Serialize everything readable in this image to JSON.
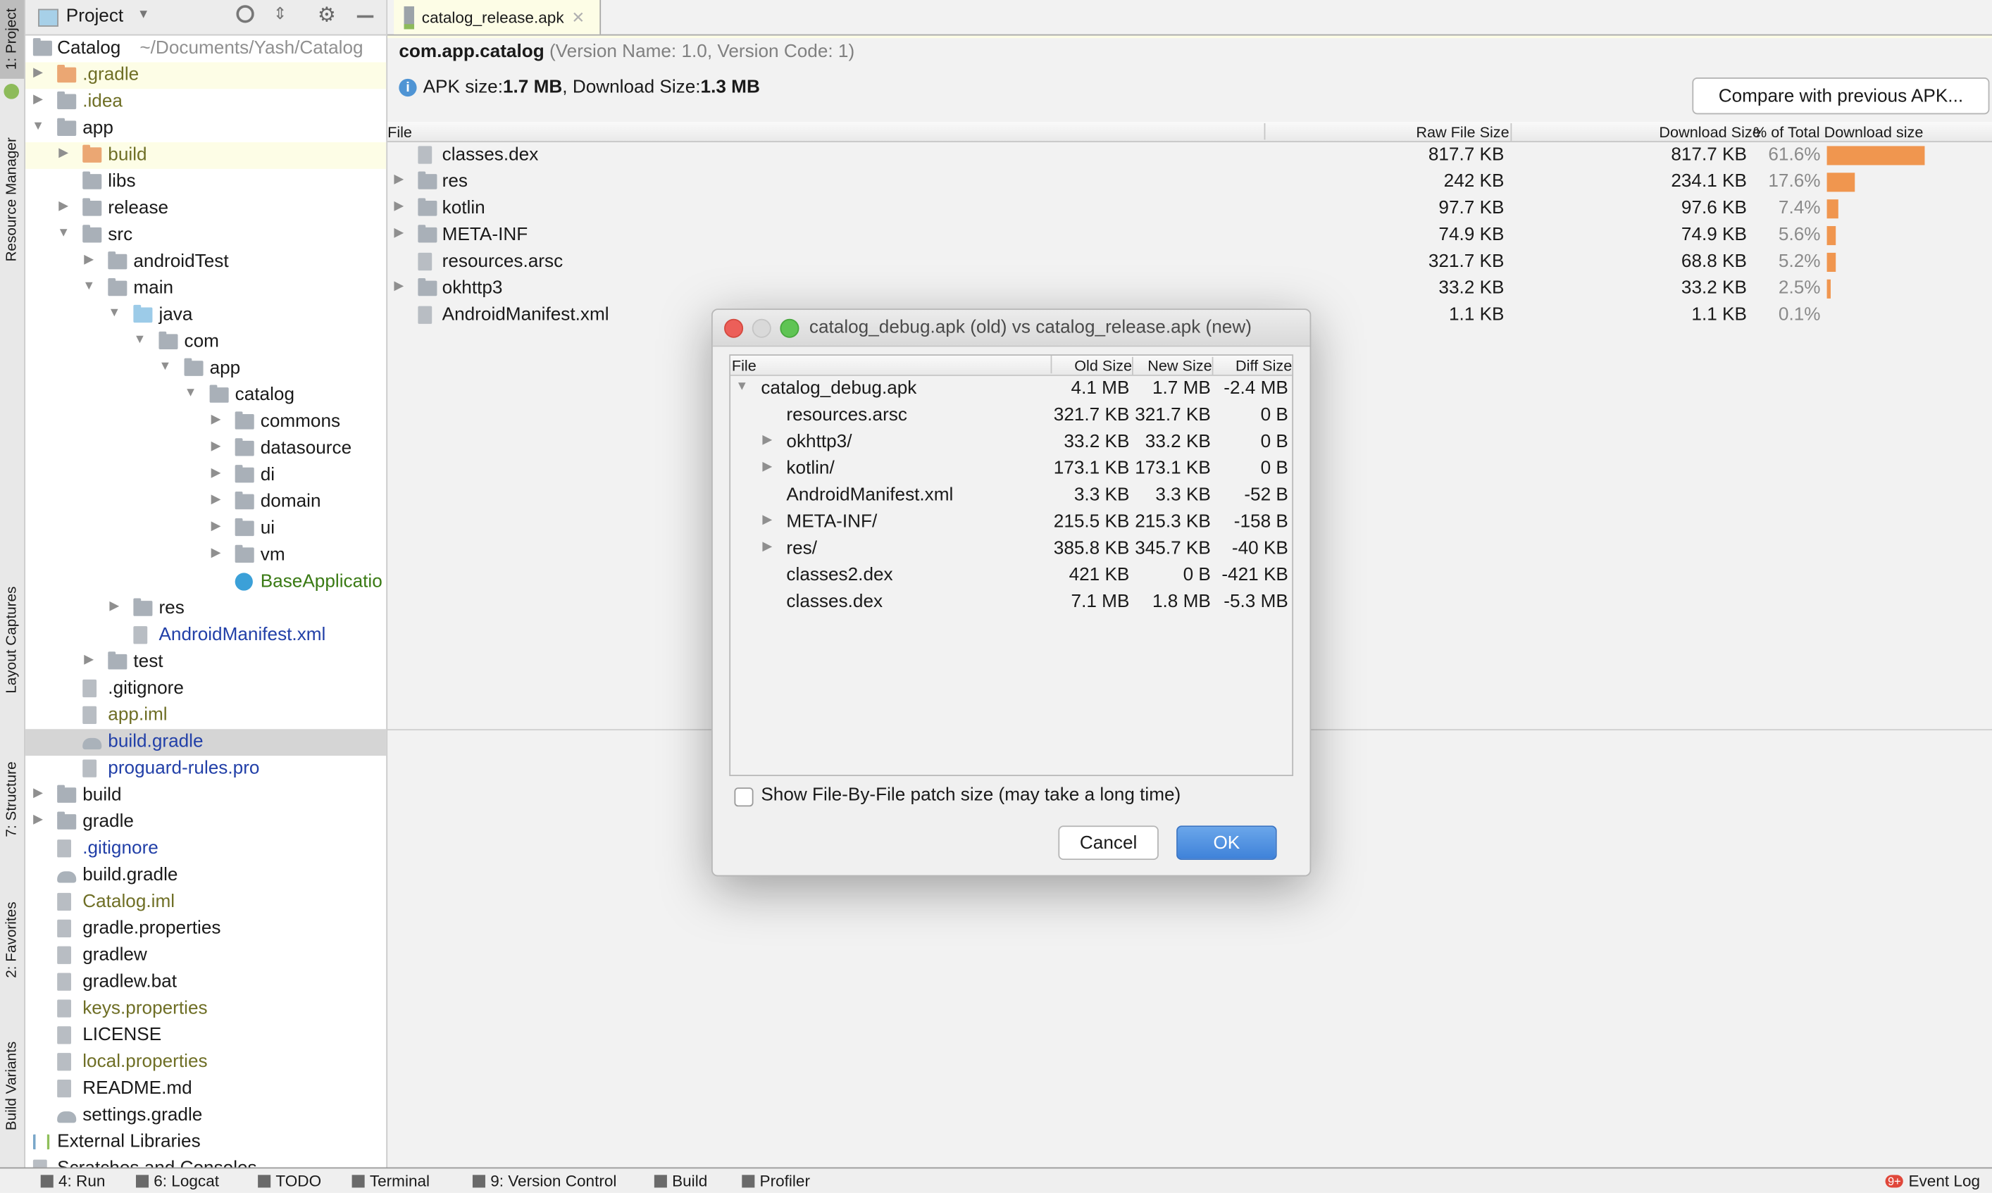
{
  "sidebar_strip": {
    "tabs": [
      "1: Project",
      "Resource Manager",
      "Layout Captures",
      "7: Structure",
      "2: Favorites",
      "Build Variants"
    ]
  },
  "project_panel": {
    "title": "Project",
    "tree": [
      {
        "label": "Catalog",
        "hint": "~/Documents/Yash/Catalog",
        "level": -1,
        "arrow": "none",
        "icon": "folder-project",
        "style": ""
      },
      {
        "label": ".gradle",
        "level": 0,
        "arrow": "right",
        "icon": "folder-excluded",
        "style": "olive",
        "row": "hl"
      },
      {
        "label": ".idea",
        "level": 0,
        "arrow": "right",
        "icon": "folder-idea",
        "style": "olive"
      },
      {
        "label": "app",
        "level": 0,
        "arrow": "down",
        "icon": "folder-module",
        "style": ""
      },
      {
        "label": "build",
        "level": 1,
        "arrow": "right",
        "icon": "folder-excluded",
        "style": "olive",
        "row": "hl"
      },
      {
        "label": "libs",
        "level": 1,
        "arrow": "none",
        "icon": "folder",
        "style": ""
      },
      {
        "label": "release",
        "level": 1,
        "arrow": "right",
        "icon": "folder",
        "style": ""
      },
      {
        "label": "src",
        "level": 1,
        "arrow": "down",
        "icon": "folder",
        "style": ""
      },
      {
        "label": "androidTest",
        "level": 2,
        "arrow": "right",
        "icon": "folder",
        "style": ""
      },
      {
        "label": "main",
        "level": 2,
        "arrow": "down",
        "icon": "folder",
        "style": ""
      },
      {
        "label": "java",
        "level": 3,
        "arrow": "down",
        "icon": "folder-source",
        "style": ""
      },
      {
        "label": "com",
        "level": 4,
        "arrow": "down",
        "icon": "package",
        "style": ""
      },
      {
        "label": "app",
        "level": 5,
        "arrow": "down",
        "icon": "package",
        "style": ""
      },
      {
        "label": "catalog",
        "level": 6,
        "arrow": "down",
        "icon": "package",
        "style": ""
      },
      {
        "label": "commons",
        "level": 7,
        "arrow": "right",
        "icon": "package",
        "style": ""
      },
      {
        "label": "datasource",
        "level": 7,
        "arrow": "right",
        "icon": "package",
        "style": ""
      },
      {
        "label": "di",
        "level": 7,
        "arrow": "right",
        "icon": "package",
        "style": ""
      },
      {
        "label": "domain",
        "level": 7,
        "arrow": "right",
        "icon": "package",
        "style": ""
      },
      {
        "label": "ui",
        "level": 7,
        "arrow": "right",
        "icon": "package",
        "style": ""
      },
      {
        "label": "vm",
        "level": 7,
        "arrow": "right",
        "icon": "package",
        "style": ""
      },
      {
        "label": "BaseApplicatio",
        "level": 7,
        "arrow": "none",
        "icon": "kotlin-class",
        "style": "green"
      },
      {
        "label": "res",
        "level": 3,
        "arrow": "right",
        "icon": "folder-res",
        "style": ""
      },
      {
        "label": "AndroidManifest.xml",
        "level": 3,
        "arrow": "none",
        "icon": "manifest-file",
        "style": "blue"
      },
      {
        "label": "test",
        "level": 2,
        "arrow": "right",
        "icon": "folder",
        "style": ""
      },
      {
        "label": ".gitignore",
        "level": 1,
        "arrow": "none",
        "icon": "file",
        "style": ""
      },
      {
        "label": "app.iml",
        "level": 1,
        "arrow": "none",
        "icon": "file",
        "style": "olive"
      },
      {
        "label": "build.gradle",
        "level": 1,
        "arrow": "none",
        "icon": "gradle-file",
        "style": "blue",
        "row": "sel"
      },
      {
        "label": "proguard-rules.pro",
        "level": 1,
        "arrow": "none",
        "icon": "file",
        "style": "blue"
      },
      {
        "label": "build",
        "level": 0,
        "arrow": "right",
        "icon": "folder",
        "style": ""
      },
      {
        "label": "gradle",
        "level": 0,
        "arrow": "right",
        "icon": "folder",
        "style": ""
      },
      {
        "label": ".gitignore",
        "level": 0,
        "arrow": "none",
        "icon": "file",
        "style": "blue"
      },
      {
        "label": "build.gradle",
        "level": 0,
        "arrow": "none",
        "icon": "gradle-file",
        "style": ""
      },
      {
        "label": "Catalog.iml",
        "level": 0,
        "arrow": "none",
        "icon": "file",
        "style": "olive"
      },
      {
        "label": "gradle.properties",
        "level": 0,
        "arrow": "none",
        "icon": "properties-file",
        "style": ""
      },
      {
        "label": "gradlew",
        "level": 0,
        "arrow": "none",
        "icon": "file",
        "style": ""
      },
      {
        "label": "gradlew.bat",
        "level": 0,
        "arrow": "none",
        "icon": "file",
        "style": ""
      },
      {
        "label": "keys.properties",
        "level": 0,
        "arrow": "none",
        "icon": "properties-file",
        "style": "olive"
      },
      {
        "label": "LICENSE",
        "level": 0,
        "arrow": "none",
        "icon": "file",
        "style": ""
      },
      {
        "label": "local.properties",
        "level": 0,
        "arrow": "none",
        "icon": "properties-file",
        "style": "olive"
      },
      {
        "label": "README.md",
        "level": 0,
        "arrow": "none",
        "icon": "file",
        "style": ""
      },
      {
        "label": "settings.gradle",
        "level": 0,
        "arrow": "none",
        "icon": "gradle-file",
        "style": ""
      },
      {
        "label": "External Libraries",
        "level": -1,
        "arrow": "none",
        "icon": "libraries",
        "style": ""
      },
      {
        "label": "Scratches and Consoles",
        "level": -1,
        "arrow": "none",
        "icon": "scratches",
        "style": ""
      }
    ]
  },
  "editor": {
    "tab_label": "catalog_release.apk",
    "package": "com.app.catalog",
    "version_info": "(Version Name: 1.0, Version Code: 1)",
    "size_prefix_apk": "APK size: ",
    "apk_size": "1.7 MB",
    "size_prefix_download": ", Download Size: ",
    "download_size": "1.3 MB",
    "compare_button": "Compare with previous APK...",
    "columns": [
      "File",
      "Raw File Size",
      "Download Size",
      "% of Total Download size"
    ],
    "accent_color": "#f0964f",
    "rows": [
      {
        "name": "classes.dex",
        "arrow": "none",
        "icon": "dex-file",
        "raw": "817.7 KB",
        "download": "817.7 KB",
        "percent_label": "61.6%",
        "percent": 61.6
      },
      {
        "name": "res",
        "arrow": "right",
        "icon": "folder-res",
        "raw": "242 KB",
        "download": "234.1 KB",
        "percent_label": "17.6%",
        "percent": 17.6
      },
      {
        "name": "kotlin",
        "arrow": "right",
        "icon": "folder",
        "raw": "97.7 KB",
        "download": "97.6 KB",
        "percent_label": "7.4%",
        "percent": 7.4
      },
      {
        "name": "META-INF",
        "arrow": "right",
        "icon": "folder",
        "raw": "74.9 KB",
        "download": "74.9 KB",
        "percent_label": "5.6%",
        "percent": 5.6
      },
      {
        "name": "resources.arsc",
        "arrow": "none",
        "icon": "arsc-file",
        "raw": "321.7 KB",
        "download": "68.8 KB",
        "percent_label": "5.2%",
        "percent": 5.2
      },
      {
        "name": "okhttp3",
        "arrow": "right",
        "icon": "folder",
        "raw": "33.2 KB",
        "download": "33.2 KB",
        "percent_label": "2.5%",
        "percent": 2.5
      },
      {
        "name": "AndroidManifest.xml",
        "arrow": "none",
        "icon": "xml-file",
        "raw": "1.1 KB",
        "download": "1.1 KB",
        "percent_label": "0.1%",
        "percent": 0.1
      }
    ]
  },
  "dialog": {
    "title": "catalog_debug.apk (old) vs catalog_release.apk (new)",
    "columns": [
      "File",
      "Old Size",
      "New Size",
      "Diff Size"
    ],
    "rows": [
      {
        "name": "catalog_debug.apk",
        "arrow": "down",
        "indent": 0,
        "old": "4.1 MB",
        "new": "1.7 MB",
        "diff": "-2.4 MB"
      },
      {
        "name": "resources.arsc",
        "arrow": "none",
        "indent": 1,
        "old": "321.7 KB",
        "new": "321.7 KB",
        "diff": "0 B"
      },
      {
        "name": "okhttp3/",
        "arrow": "right",
        "indent": 1,
        "old": "33.2 KB",
        "new": "33.2 KB",
        "diff": "0 B"
      },
      {
        "name": "kotlin/",
        "arrow": "right",
        "indent": 1,
        "old": "173.1 KB",
        "new": "173.1 KB",
        "diff": "0 B"
      },
      {
        "name": "AndroidManifest.xml",
        "arrow": "none",
        "indent": 1,
        "old": "3.3 KB",
        "new": "3.3 KB",
        "diff": "-52 B"
      },
      {
        "name": "META-INF/",
        "arrow": "right",
        "indent": 1,
        "old": "215.5 KB",
        "new": "215.3 KB",
        "diff": "-158 B"
      },
      {
        "name": "res/",
        "arrow": "right",
        "indent": 1,
        "old": "385.8 KB",
        "new": "345.7 KB",
        "diff": "-40 KB"
      },
      {
        "name": "classes2.dex",
        "arrow": "none",
        "indent": 1,
        "old": "421 KB",
        "new": "0 B",
        "diff": "-421 KB"
      },
      {
        "name": "classes.dex",
        "arrow": "none",
        "indent": 1,
        "old": "7.1 MB",
        "new": "1.8 MB",
        "diff": "-5.3 MB"
      }
    ],
    "checkbox_label": "Show File-By-File patch size (may take a long time)",
    "checkbox_checked": false,
    "cancel_label": "Cancel",
    "ok_label": "OK",
    "ok_color": "#4a8ad8"
  },
  "bottom_bar": {
    "items": [
      {
        "label": "4: Run",
        "icon": "run-icon"
      },
      {
        "label": "6: Logcat",
        "icon": "logcat-icon"
      },
      {
        "label": "TODO",
        "icon": "todo-icon"
      },
      {
        "label": "Terminal",
        "icon": "terminal-icon"
      },
      {
        "label": "9: Version Control",
        "icon": "version-control-icon"
      },
      {
        "label": "Build",
        "icon": "build-icon"
      },
      {
        "label": "Profiler",
        "icon": "profiler-icon"
      }
    ],
    "event_log_badge": "9+",
    "event_log_label": "Event Log"
  }
}
